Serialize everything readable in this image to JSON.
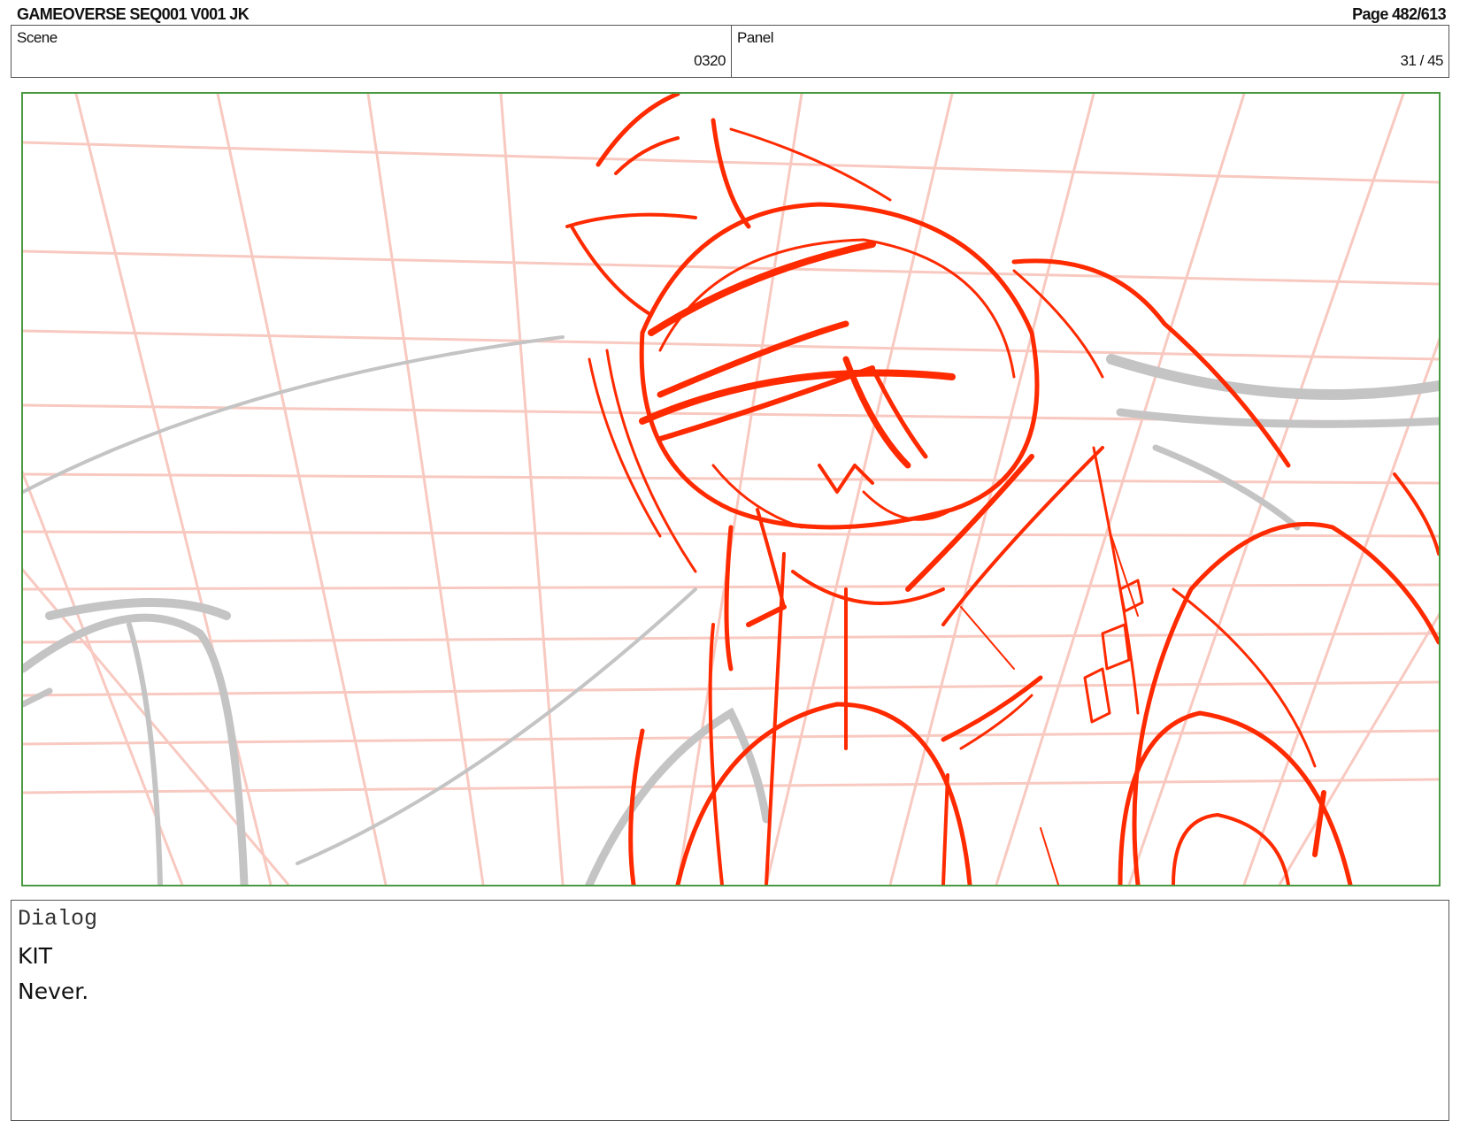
{
  "header": {
    "title": "GAMEOVERSE SEQ001 V001 JK",
    "page": "Page 482/613"
  },
  "scene": {
    "label": "Scene",
    "value": "0320"
  },
  "panel": {
    "label": "Panel",
    "value": "31 / 45"
  },
  "frame": {
    "border_color": "#4a9a44",
    "grid_color": "#f8c9c0",
    "sketch_color": "#ff2a00",
    "rough_color": "#c4c4c4"
  },
  "dialog": {
    "label": "Dialog",
    "character": "KIT",
    "line": "Never."
  }
}
